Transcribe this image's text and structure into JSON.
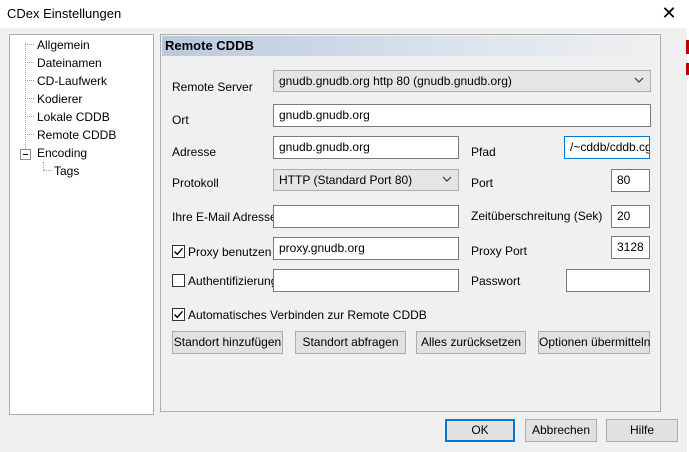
{
  "window": {
    "title": "CDex Einstellungen",
    "close_glyph": "✕"
  },
  "tree": {
    "items": [
      {
        "label": "Allgemein"
      },
      {
        "label": "Dateinamen"
      },
      {
        "label": "CD-Laufwerk"
      },
      {
        "label": "Kodierer"
      },
      {
        "label": "Lokale CDDB"
      },
      {
        "label": "Remote CDDB",
        "selected": true
      },
      {
        "label": "Encoding",
        "expanded": true
      },
      {
        "label": "Tags"
      }
    ]
  },
  "panel": {
    "title": "Remote CDDB",
    "remote_server": {
      "label": "Remote Server",
      "value": "gnudb.gnudb.org http  80  (gnudb.gnudb.org)"
    },
    "ort": {
      "label": "Ort",
      "value": "gnudb.gnudb.org"
    },
    "adresse": {
      "label": "Adresse",
      "value": "gnudb.gnudb.org"
    },
    "pfad": {
      "label": "Pfad",
      "value": "/~cddb/cddb.cg"
    },
    "protokoll": {
      "label": "Protokoll",
      "value": "HTTP (Standard Port 80)"
    },
    "port": {
      "label": "Port",
      "value": "80"
    },
    "email": {
      "label": "Ihre E-Mail Adresse",
      "value": ""
    },
    "timeout": {
      "label": "Zeitüberschreitung (Sek)",
      "value": "20"
    },
    "proxy": {
      "label": "Proxy benutzen",
      "checked": true,
      "value": "proxy.gnudb.org"
    },
    "proxy_port": {
      "label": "Proxy Port",
      "value": "3128"
    },
    "auth": {
      "label": "Authentifizierung",
      "checked": false,
      "value": ""
    },
    "passwort": {
      "label": "Passwort",
      "value": ""
    },
    "auto_connect": {
      "label": "Automatisches Verbinden zur Remote CDDB",
      "checked": true
    },
    "buttons": {
      "add_location": "Standort hinzufügen",
      "query_location": "Standort abfragen",
      "reset_all": "Alles zurücksetzen",
      "submit_options": "Optionen übermitteln"
    }
  },
  "footer": {
    "ok": "OK",
    "cancel": "Abbrechen",
    "help": "Hilfe"
  }
}
